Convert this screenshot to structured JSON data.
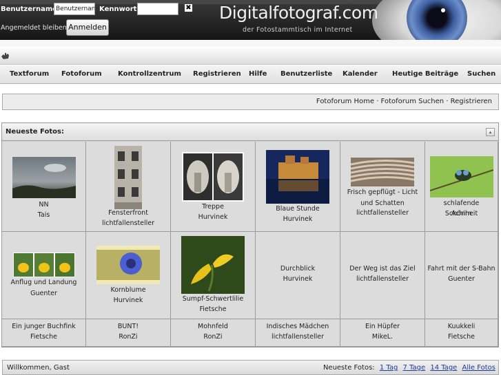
{
  "header": {
    "username_label": "Benutzername:",
    "username_value": "Benutzernan",
    "password_label": "Kennwort:",
    "close_symbol": "✖",
    "remember_label": "Angemeldet bleiben?",
    "login_button": "Anmelden",
    "site_title": "Digitalfotograf.com",
    "tagline": "der Fotostammtisch im Internet"
  },
  "toolbar": {
    "icon": "hand-icon"
  },
  "nav": {
    "items": [
      "Textforum",
      "Fotoforum",
      "Kontrollzentrum",
      "Registrieren",
      "Hilfe",
      "Benutzerliste",
      "Kalender",
      "Heutige Beiträge",
      "Suchen"
    ]
  },
  "links": {
    "text": "Fotoforum Home · Fotoforum Suchen · Registrieren"
  },
  "gallery": {
    "title": "Neueste Fotos:",
    "rows": [
      [
        {
          "title": "NN",
          "author": "Tais"
        },
        {
          "title": "Fensterfront",
          "author": "lichtfallensteller"
        },
        {
          "title": "Treppe",
          "author": "Hurvinek"
        },
        {
          "title": "Blaue Stunde",
          "author": "Hurvinek"
        },
        {
          "title": "Frisch gepflügt - Licht und Schatten",
          "author": "lichtfallensteller"
        },
        {
          "title": "schlafende Schönheit",
          "author": "Achim"
        }
      ],
      [
        {
          "title": "Anflug und Landung",
          "author": "Guenter"
        },
        {
          "title": "Kornblume",
          "author": "Hurvinek"
        },
        {
          "title": "Sumpf-Schwertlilie",
          "author": "Fietsche"
        },
        {
          "title": "Durchblick",
          "author": "Hurvinek"
        },
        {
          "title": "Der Weg ist das Ziel",
          "author": "lichtfallensteller"
        },
        {
          "title": "Fahrt mit der S-Bahn",
          "author": "Guenter"
        }
      ],
      [
        {
          "title": "Ein junger Buchfink",
          "author": "Fietsche"
        },
        {
          "title": "BUNT!",
          "author": "RonZi"
        },
        {
          "title": "Mohnfeld",
          "author": "RonZi"
        },
        {
          "title": "Indisches Mädchen",
          "author": "lichtfallensteller"
        },
        {
          "title": "Ein Hüpfer",
          "author": "MikeL."
        },
        {
          "title": "Kuukkeli",
          "author": "Fietsche"
        }
      ]
    ]
  },
  "footer": {
    "welcome": "Willkommen, Gast",
    "newest_label": "Neueste Fotos:",
    "links": [
      "1 Tag",
      "7 Tage",
      "14 Tage",
      "Alle Fotos"
    ]
  }
}
